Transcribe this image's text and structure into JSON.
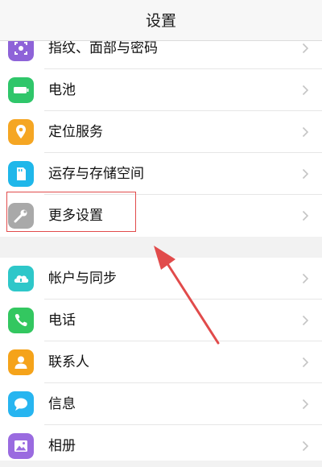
{
  "header": {
    "title": "设置"
  },
  "settings_group_1": [
    {
      "label": "指纹、面部与密码",
      "icon": "fingerprint-face-icon",
      "color": "#8e63d8"
    },
    {
      "label": "电池",
      "icon": "battery-icon",
      "color": "#2fc66a"
    },
    {
      "label": "定位服务",
      "icon": "location-pin-icon",
      "color": "#f5a623"
    },
    {
      "label": "运存与存储空间",
      "icon": "storage-card-icon",
      "color": "#1fb7ea"
    },
    {
      "label": "更多设置",
      "icon": "wrench-icon",
      "color": "#a9a9a9"
    }
  ],
  "settings_group_2": [
    {
      "label": "帐户与同步",
      "icon": "cloud-sync-icon",
      "color": "#2ec7c9"
    },
    {
      "label": "电话",
      "icon": "phone-icon",
      "color": "#33c760"
    },
    {
      "label": "联系人",
      "icon": "contact-icon",
      "color": "#f5a31a"
    },
    {
      "label": "信息",
      "icon": "message-icon",
      "color": "#27b5f0"
    },
    {
      "label": "相册",
      "icon": "gallery-icon",
      "color": "#9a6be0"
    }
  ],
  "annotation": {
    "highlight_color": "#e14b4b",
    "target": "更多设置"
  }
}
